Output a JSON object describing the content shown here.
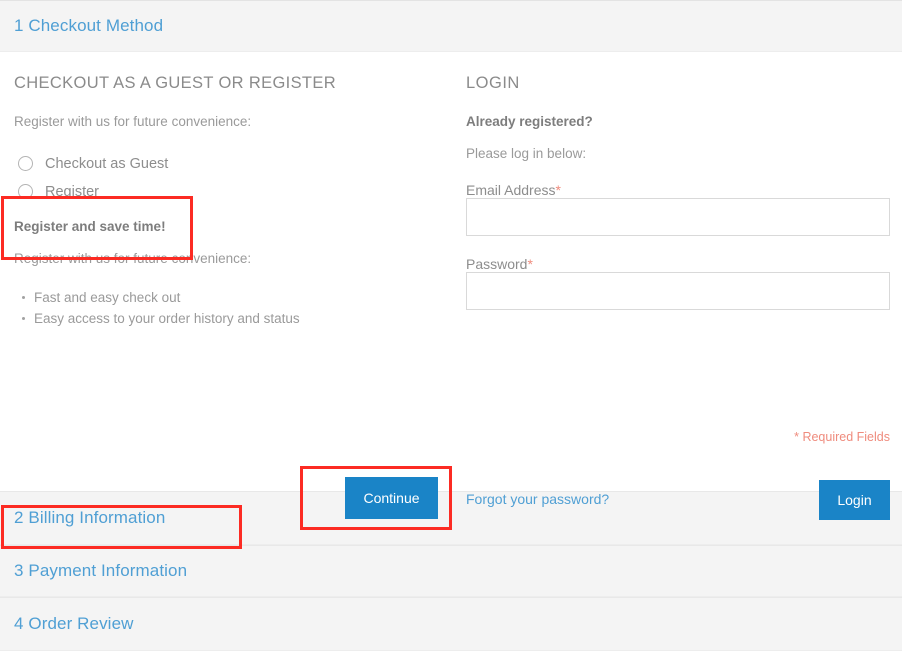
{
  "steps": [
    {
      "number": "1",
      "label": "Checkout Method",
      "title": "1 Checkout Method",
      "state": "active"
    },
    {
      "number": "2",
      "label": "Billing Information",
      "title": "2 Billing Information",
      "state": "collapsed"
    },
    {
      "number": "3",
      "label": "Payment Information",
      "title": "3 Payment Information",
      "state": "collapsed"
    },
    {
      "number": "4",
      "label": "Order Review",
      "title": "4 Order Review",
      "state": "collapsed"
    }
  ],
  "guest": {
    "heading": "CHECKOUT AS A GUEST OR REGISTER",
    "intro": "Register with us for future convenience:",
    "options": [
      {
        "label": "Checkout as Guest",
        "checked": false
      },
      {
        "label": "Register",
        "checked": false
      }
    ],
    "save_time_heading": "Register and save time!",
    "save_time_intro": "Register with us for future convenience:",
    "benefits": [
      "Fast and easy check out",
      "Easy access to your order history and status"
    ],
    "continue_label": "Continue"
  },
  "login": {
    "heading": "LOGIN",
    "already_registered": "Already registered?",
    "please_log_in": "Please log in below:",
    "email": {
      "label": "Email Address",
      "required_mark": "*",
      "value": "",
      "placeholder": ""
    },
    "password": {
      "label": "Password",
      "required_mark": "*",
      "value": "",
      "placeholder": ""
    },
    "required_fields_note": "* Required Fields",
    "forgot_password_link": "Forgot your password?",
    "login_label": "Login"
  },
  "colors": {
    "link_blue": "#4f9fd4",
    "button_blue": "#1a84c7",
    "required_red": "#ef8b7d",
    "annotation_red": "#fc2b23",
    "header_bg": "#f4f4f4",
    "text_gray": "#8d8d8d"
  }
}
